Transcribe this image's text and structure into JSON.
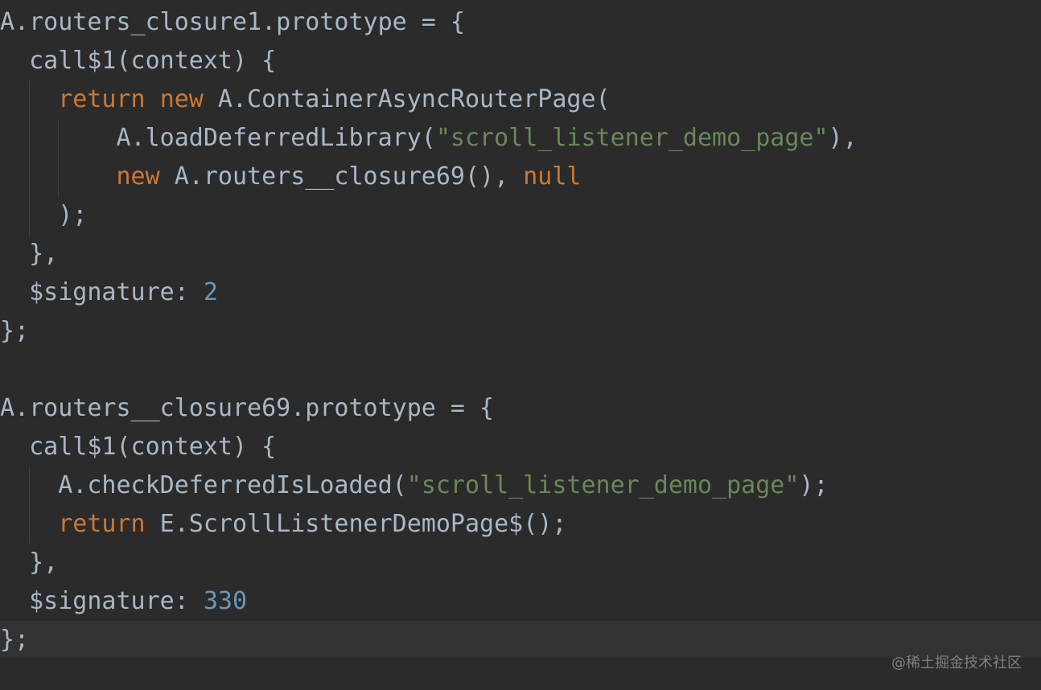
{
  "code_lines": [
    [
      {
        "t": "A.routers_closure1.prototype = {",
        "c": "plain"
      }
    ],
    [
      {
        "t": "  call$1(context) {",
        "c": "plain"
      }
    ],
    [
      {
        "t": "    ",
        "c": "plain"
      },
      {
        "t": "return",
        "c": "kw"
      },
      {
        "t": " ",
        "c": "plain"
      },
      {
        "t": "new",
        "c": "kw"
      },
      {
        "t": " A.ContainerAsyncRouterPage(",
        "c": "plain"
      }
    ],
    [
      {
        "t": "        A.loadDeferredLibrary(",
        "c": "plain"
      },
      {
        "t": "\"scroll_listener_demo_page\"",
        "c": "str"
      },
      {
        "t": "),",
        "c": "plain"
      }
    ],
    [
      {
        "t": "        ",
        "c": "plain"
      },
      {
        "t": "new",
        "c": "kw"
      },
      {
        "t": " A.routers__closure69(), ",
        "c": "plain"
      },
      {
        "t": "null",
        "c": "kw"
      }
    ],
    [
      {
        "t": "    );",
        "c": "plain"
      }
    ],
    [
      {
        "t": "  },",
        "c": "plain"
      }
    ],
    [
      {
        "t": "  $signature: ",
        "c": "plain"
      },
      {
        "t": "2",
        "c": "num"
      }
    ],
    [
      {
        "t": "};",
        "c": "plain"
      }
    ],
    [
      {
        "t": "",
        "c": "plain"
      }
    ],
    [
      {
        "t": "A.routers__closure69.prototype = {",
        "c": "plain"
      }
    ],
    [
      {
        "t": "  call$1(context) {",
        "c": "plain"
      }
    ],
    [
      {
        "t": "    A.checkDeferredIsLoaded(",
        "c": "plain"
      },
      {
        "t": "\"scroll_listener_demo_page\"",
        "c": "str"
      },
      {
        "t": ");",
        "c": "plain"
      }
    ],
    [
      {
        "t": "    ",
        "c": "plain"
      },
      {
        "t": "return",
        "c": "kw"
      },
      {
        "t": " E.ScrollListenerDemoPage$();",
        "c": "plain"
      }
    ],
    [
      {
        "t": "  },",
        "c": "plain"
      }
    ],
    [
      {
        "t": "  $signature: ",
        "c": "plain"
      },
      {
        "t": "330",
        "c": "num"
      }
    ],
    [
      {
        "t": "};",
        "c": "plain"
      }
    ]
  ],
  "current_line_index": 16,
  "watermark": "@稀土掘金技术社区",
  "colors": {
    "background": "#2b2b2b",
    "current_line": "#323232",
    "text": "#a9b7c6",
    "keyword": "#cc7832",
    "string": "#6a8759",
    "number": "#6897bb"
  }
}
